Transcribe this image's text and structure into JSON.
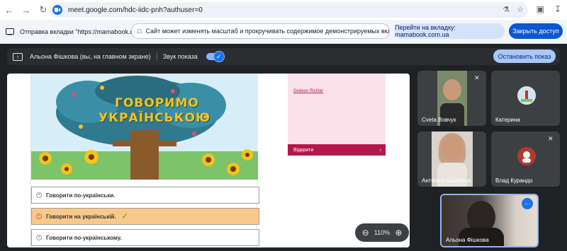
{
  "browser": {
    "url": "meet.google.com/hdc-iidc-pnh?authuser=0",
    "icons": [
      "back-icon",
      "forward-icon",
      "reload-icon",
      "translate-icon",
      "star-icon",
      "extensions-icon",
      "download-icon"
    ]
  },
  "infobar": {
    "sharing_text": "Отправка вкладки \"https://mamabook.co...",
    "message": "Сайт может изменять масштаб и прокручивать содержимое демонстрируемых вкладок",
    "goto_button": "Перейти на вкладку: mamabook.com.ua",
    "close_access_button": "Закрыть доступ"
  },
  "meetbar": {
    "presenter": "Альона Фішкова (вы, на главном экране)",
    "sound_label": "Звук показа",
    "sound_on": true,
    "stop_button": "Остановить показ"
  },
  "shared_screen": {
    "poster_title_line1": "ГОВОРИМО",
    "poster_title_line2": "УКРАЇНСЬКОЮ",
    "options": [
      {
        "label": "Говорити по-українськи.",
        "selected": false
      },
      {
        "label": "Говорити на українській.",
        "selected": true
      },
      {
        "label": "Говорити по-українському.",
        "selected": false
      }
    ],
    "card_author": "Gedeon Richter",
    "card_open": "Відкрити",
    "zoom_level": "110%"
  },
  "participants": [
    {
      "name": "Cveta Вовчук",
      "muted": true,
      "video": true
    },
    {
      "name": "Катерина",
      "muted": false,
      "video": false
    },
    {
      "name": "Антоніна Шалигіна",
      "muted": false,
      "video": true
    },
    {
      "name": "Влад Курандо",
      "muted": true,
      "video": false
    }
  ],
  "self": {
    "name": "Альона Фішкова"
  }
}
